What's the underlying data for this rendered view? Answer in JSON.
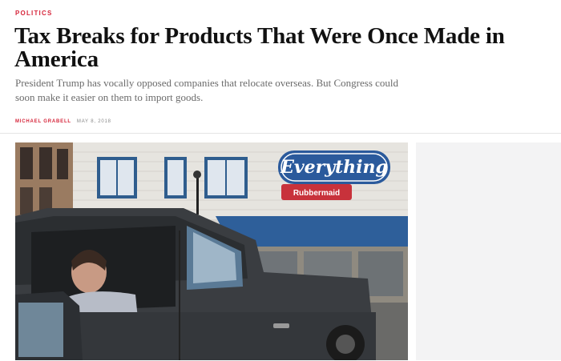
{
  "article": {
    "section": "POLITICS",
    "headline": "Tax Breaks for Products That Were Once Made in America",
    "dek": "President Trump has vocally opposed companies that relocate overseas. But Congress could soon make it easier on them to import goods.",
    "author": "MICHAEL GRABELL",
    "date": "MAY 8, 2018"
  },
  "hero": {
    "store_sign": "Everything",
    "store_subsign": "Rubbermaid"
  },
  "colors": {
    "accent": "#d6263b",
    "dek": "#6b6b6b",
    "sign_blue": "#2b5a9c",
    "sign_red": "#c8323b"
  }
}
